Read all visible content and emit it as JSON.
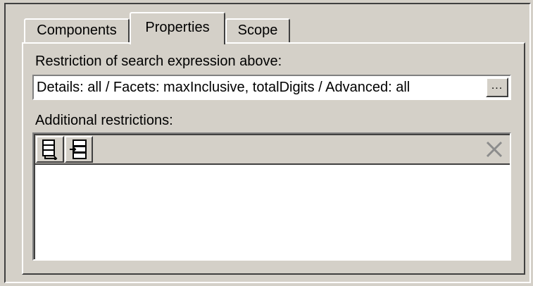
{
  "tabs": {
    "components": "Components",
    "properties": "Properties",
    "scope": "Scope",
    "active": "Properties"
  },
  "restriction": {
    "label": "Restriction of search expression above:",
    "value": "Details: all / Facets: maxInclusive, totalDigits / Advanced: all",
    "browse_label": "..."
  },
  "additional": {
    "label": "Additional restrictions:",
    "toolbar": {
      "buttons": [
        {
          "icon": "insert-restriction-icon"
        },
        {
          "icon": "append-restriction-icon"
        },
        {
          "icon": "delete-icon"
        }
      ]
    },
    "rows": []
  }
}
